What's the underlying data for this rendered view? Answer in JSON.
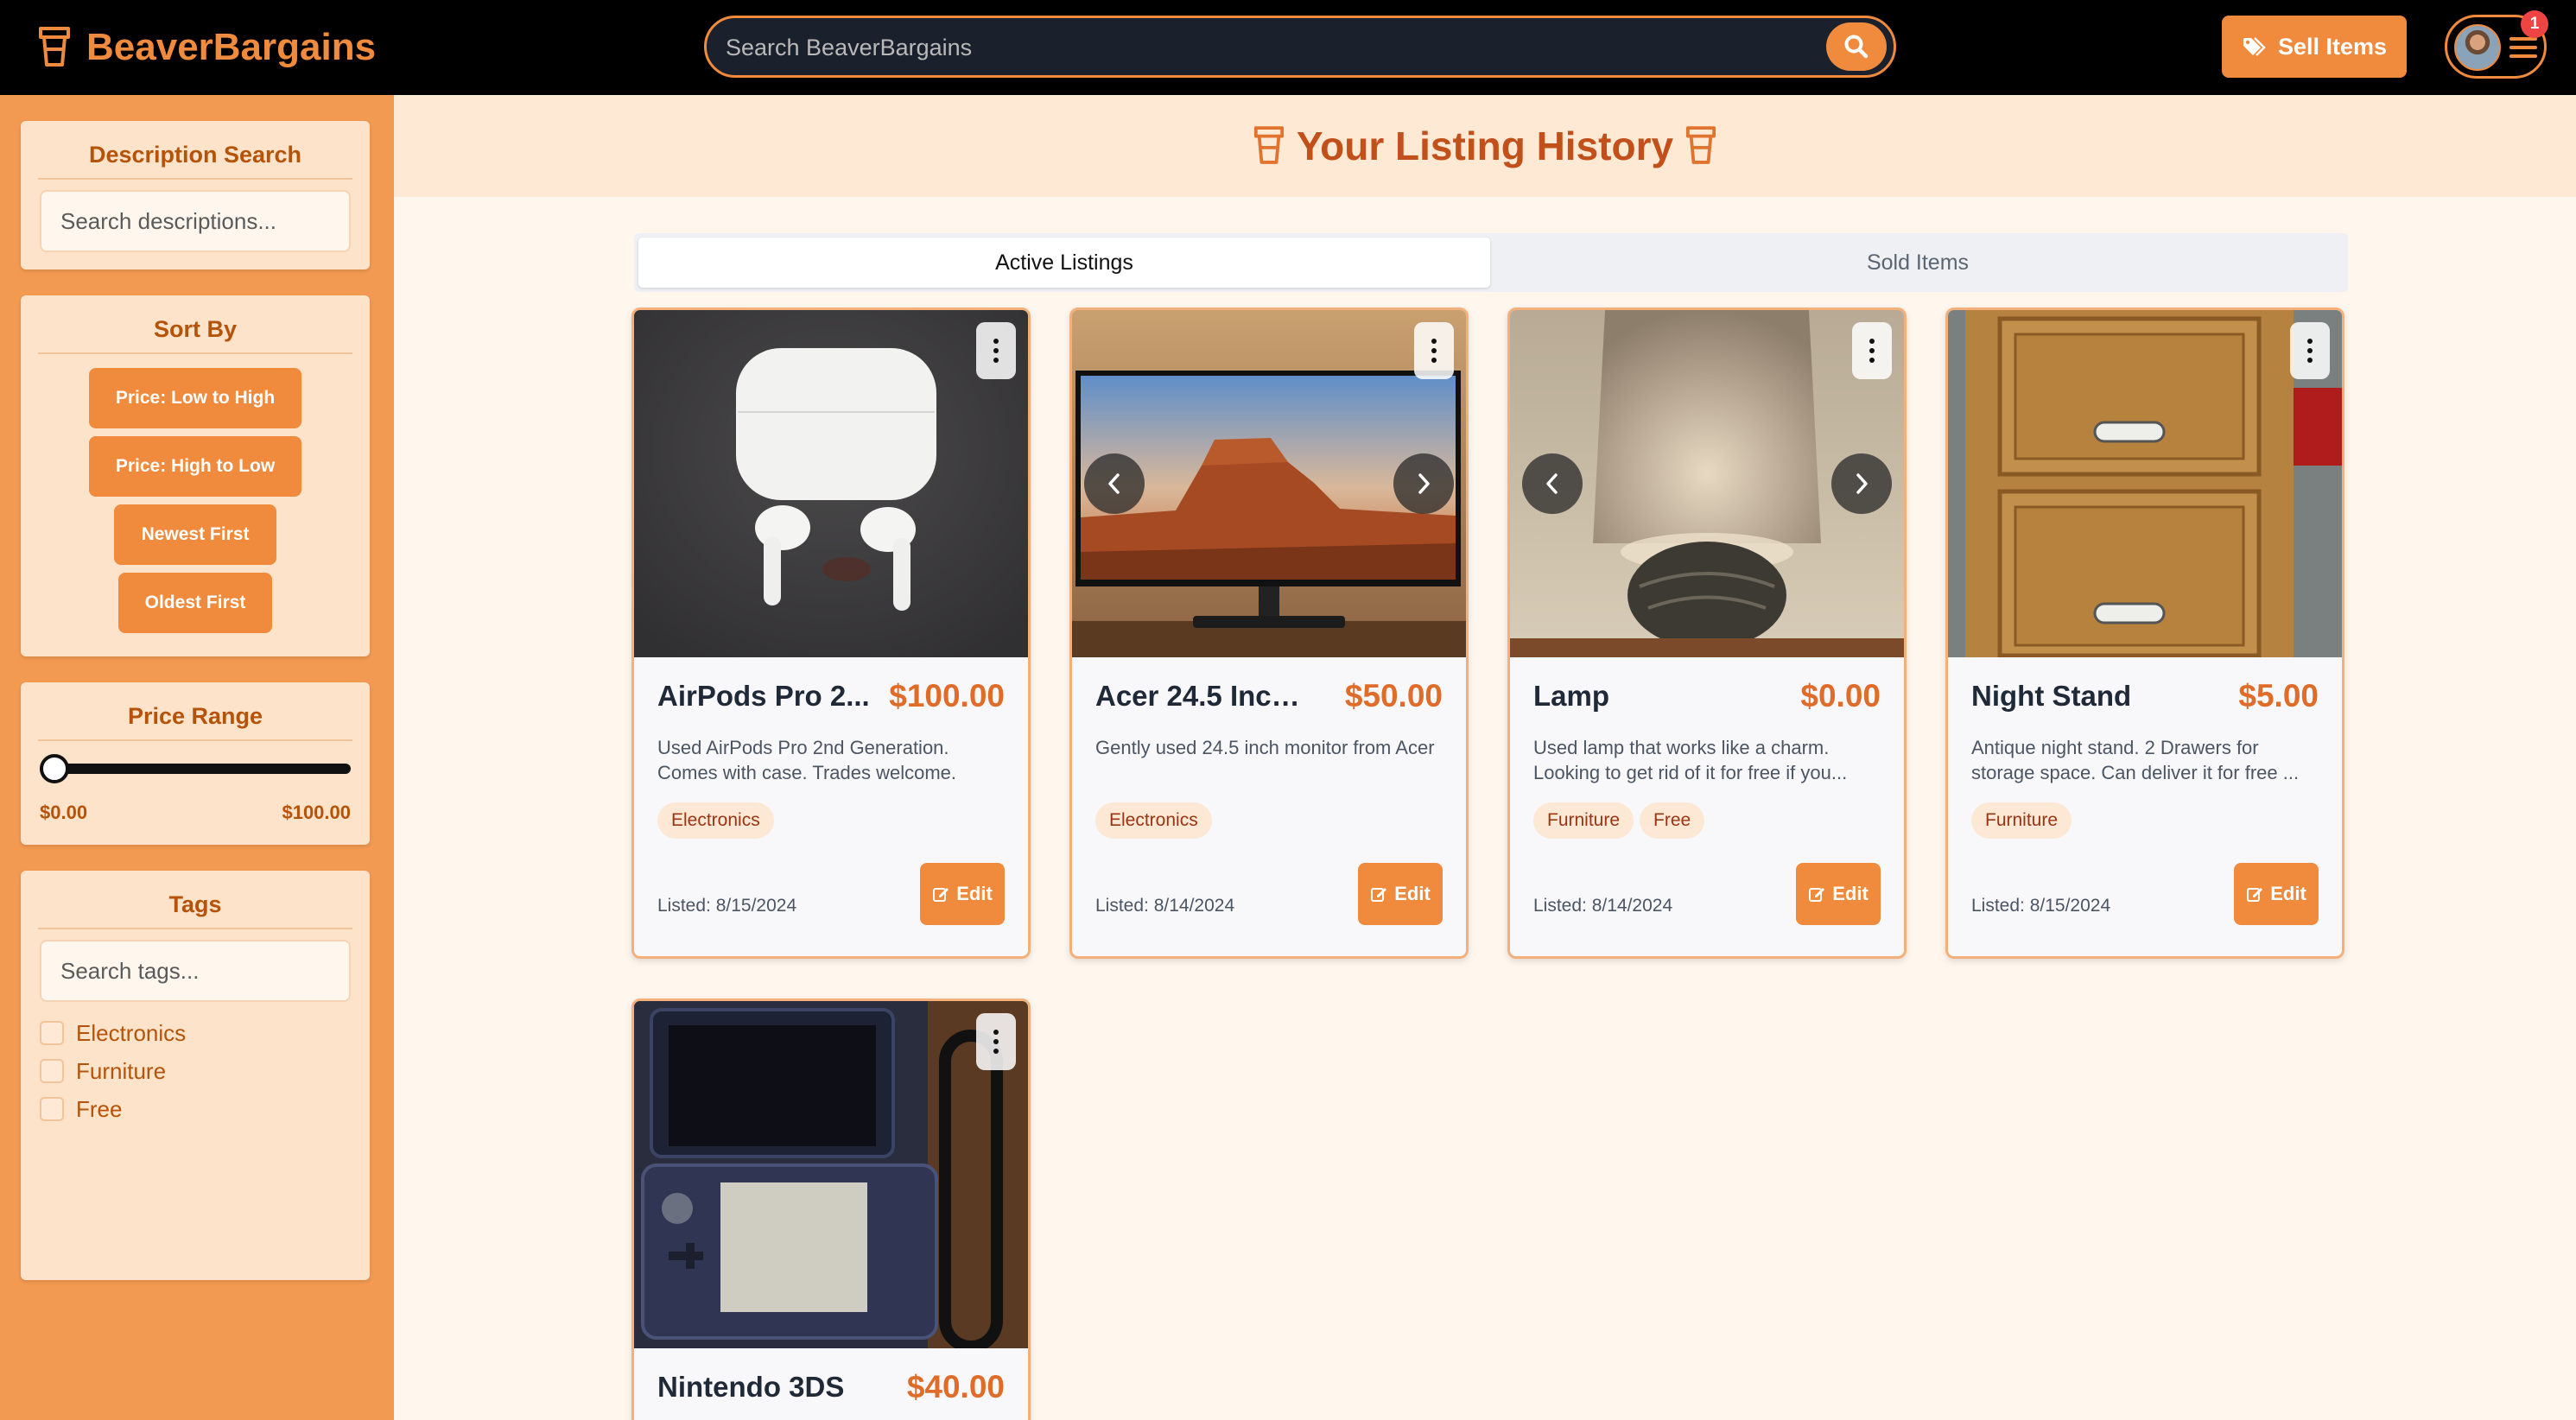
{
  "header": {
    "brand": "BeaverBargains",
    "search_placeholder": "Search BeaverBargains",
    "sell_label": "Sell Items",
    "notification_count": "1"
  },
  "sidebar": {
    "description_search": {
      "title": "Description Search",
      "placeholder": "Search descriptions..."
    },
    "sort": {
      "title": "Sort By",
      "options": [
        "Price: Low to High",
        "Price: High to Low",
        "Newest First",
        "Oldest First"
      ]
    },
    "price_range": {
      "title": "Price Range",
      "min_label": "$0.00",
      "max_label": "$100.00",
      "value_fraction": 0
    },
    "tags": {
      "title": "Tags",
      "placeholder": "Search tags...",
      "items": [
        "Electronics",
        "Furniture",
        "Free"
      ]
    }
  },
  "main": {
    "title": "Your Listing History",
    "tabs": [
      "Active Listings",
      "Sold Items"
    ],
    "active_tab": "Active Listings",
    "edit_label": "Edit",
    "listings": [
      {
        "title": "AirPods Pro 2...",
        "price": "$100.00",
        "description": "Used AirPods Pro 2nd Generation. Comes with case. Trades welcome.",
        "tags": [
          "Electronics"
        ],
        "listed": "Listed: 8/15/2024"
      },
      {
        "title": "Acer 24.5 Inch ...",
        "price": "$50.00",
        "description": "Gently used 24.5 inch monitor from Acer",
        "tags": [
          "Electronics"
        ],
        "listed": "Listed: 8/14/2024"
      },
      {
        "title": "Lamp",
        "price": "$0.00",
        "description": "Used lamp that works like a charm. Looking to get rid of it for free if you...",
        "tags": [
          "Furniture",
          "Free"
        ],
        "listed": "Listed: 8/14/2024"
      },
      {
        "title": "Night Stand",
        "price": "$5.00",
        "description": "Antique night stand. 2 Drawers for storage space. Can deliver it for free ...",
        "tags": [
          "Furniture"
        ],
        "listed": "Listed: 8/15/2024"
      },
      {
        "title": "Nintendo 3DS",
        "price": "$40.00"
      }
    ]
  },
  "colors": {
    "accent": "#f08a3c",
    "sidebar_bg": "#f39a52",
    "panel_bg": "#fce3c9",
    "price": "#e06c2a",
    "title_brown": "#c2501a"
  }
}
